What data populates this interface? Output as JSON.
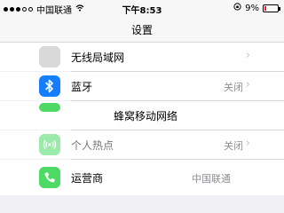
{
  "status": {
    "carrier": "中国联通",
    "time": "下午8:53",
    "battery": "9%"
  },
  "nav": {
    "title": "设置"
  },
  "rows": {
    "wifi": {
      "label": "无线局域网",
      "value": ""
    },
    "bluetooth": {
      "label": "蓝牙",
      "value": "关闭"
    },
    "cellular": {
      "label": "蜂窝移动网络"
    },
    "hotspot": {
      "label": "个人热点",
      "value": "关闭"
    },
    "carrier": {
      "label": "运营商",
      "value": "中国联通"
    }
  },
  "colors": {
    "bluetooth_icon": "#147efb",
    "cellular_icon": "#4cd964",
    "hotspot_icon": "#4cd964",
    "phone_icon": "#4cd964"
  }
}
